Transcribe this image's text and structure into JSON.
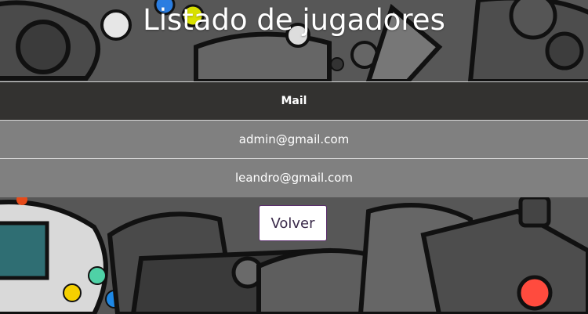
{
  "page": {
    "title": "Listado de jugadores"
  },
  "table": {
    "header": "Mail",
    "rows": [
      "admin@gmail.com",
      "leandro@gmail.com"
    ]
  },
  "actions": {
    "back_label": "Volver"
  },
  "colors": {
    "header_bg": "#333230",
    "row_bg": "#808080",
    "button_border": "#5a2d6b"
  }
}
